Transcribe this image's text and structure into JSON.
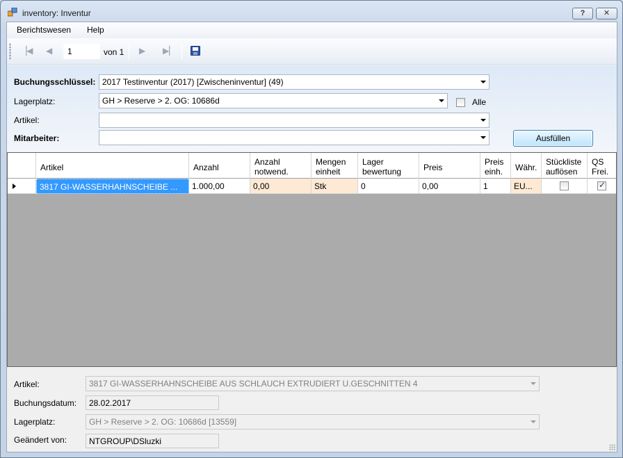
{
  "window": {
    "title": "inventory: Inventur",
    "help_label": "?",
    "close_label": "✕"
  },
  "menu": {
    "items": [
      "Berichtswesen",
      "Help"
    ]
  },
  "toolbar": {
    "position": "1",
    "of_label": "von 1"
  },
  "filters": {
    "buchungsschluessel": {
      "label": "Buchungsschlüssel:",
      "value": "2017 Testinventur (2017) [Zwischeninventur] (49)"
    },
    "lagerplatz": {
      "label": "Lagerplatz:",
      "value": "GH > Reserve > 2. OG: 10686d"
    },
    "alle_label": "Alle",
    "artikel": {
      "label": "Artikel:",
      "value": ""
    },
    "mitarbeiter": {
      "label": "Mitarbeiter:",
      "value": ""
    },
    "fill_button": "Ausfüllen"
  },
  "grid": {
    "headers": [
      [
        "Artikel"
      ],
      [
        "Anzahl"
      ],
      [
        "Anzahl",
        "notwend."
      ],
      [
        "Mengen",
        "einheit"
      ],
      [
        "Lager",
        "bewertung"
      ],
      [
        "Preis"
      ],
      [
        "Preis",
        "einh."
      ],
      [
        "Währ."
      ],
      [
        "Stückliste",
        "auflösen"
      ],
      [
        "QS",
        "Frei."
      ]
    ],
    "row": {
      "artikel": "3817     GI-WASSERHAHNSCHEIBE ...",
      "anzahl": "1.000,00",
      "anzahl_notwend": "0,00",
      "mengeneinheit": "Stk",
      "lagerbewertung": "0",
      "preis": "0,00",
      "preis_einh": "1",
      "waehrung": "EU...",
      "stueckliste_aufloesen": false,
      "qs_frei": true
    }
  },
  "details": {
    "artikel": {
      "label": "Artikel:",
      "value": "3817     GI-WASSERHAHNSCHEIBE AUS SCHLAUCH EXTRUDIERT U.GESCHNITTEN 4"
    },
    "buchungsdatum": {
      "label": "Buchungsdatum:",
      "value": "28.02.2017"
    },
    "lagerplatz": {
      "label": "Lagerplatz:",
      "value": "GH > Reserve > 2. OG: 10686d [13559]"
    },
    "geaendert_von": {
      "label": "Geändert von:",
      "value": "NTGROUP\\DSluzki"
    }
  },
  "colors": {
    "selection": "#3399ff",
    "required_cell": "#fde9d4",
    "grid_background": "#ababab"
  }
}
